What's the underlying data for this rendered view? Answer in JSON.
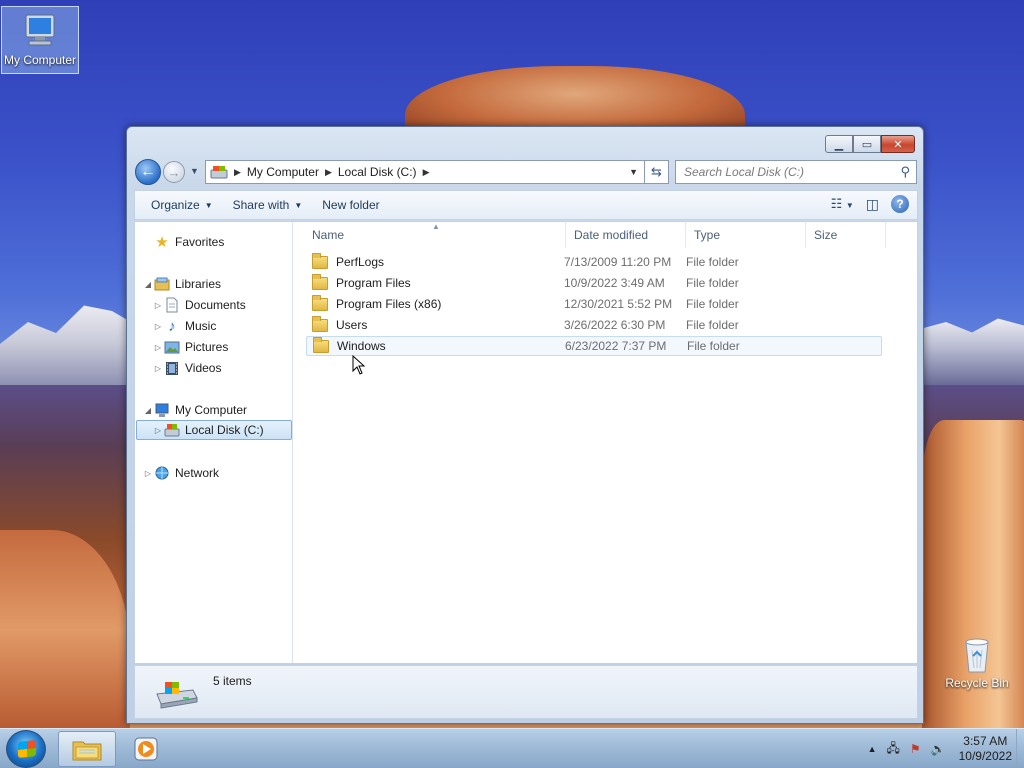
{
  "desktop": {
    "icons": [
      {
        "label": "My Computer",
        "icon": "computer-icon"
      },
      {
        "label": "Recycle Bin",
        "icon": "recycle-bin-icon"
      }
    ]
  },
  "window": {
    "controls": {
      "minimize": "minimize",
      "maximize": "maximize",
      "close": "close"
    },
    "address": {
      "crumbs": [
        "My Computer",
        "Local Disk (C:)"
      ]
    },
    "search": {
      "placeholder": "Search Local Disk (C:)"
    },
    "toolbar": {
      "organize": "Organize",
      "share_with": "Share with",
      "new_folder": "New folder"
    },
    "nav": {
      "favorites": "Favorites",
      "libraries": "Libraries",
      "documents": "Documents",
      "music": "Music",
      "pictures": "Pictures",
      "videos": "Videos",
      "my_computer": "My Computer",
      "local_disk": "Local Disk (C:)",
      "network": "Network"
    },
    "columns": {
      "name": "Name",
      "date": "Date modified",
      "type": "Type",
      "size": "Size"
    },
    "files": [
      {
        "name": "PerfLogs",
        "date": "7/13/2009 11:20 PM",
        "type": "File folder"
      },
      {
        "name": "Program Files",
        "date": "10/9/2022 3:49 AM",
        "type": "File folder"
      },
      {
        "name": "Program Files (x86)",
        "date": "12/30/2021 5:52 PM",
        "type": "File folder"
      },
      {
        "name": "Users",
        "date": "3/26/2022 6:30 PM",
        "type": "File folder"
      },
      {
        "name": "Windows",
        "date": "6/23/2022 7:37 PM",
        "type": "File folder"
      }
    ],
    "status": {
      "item_count": "5 items"
    }
  },
  "taskbar": {
    "clock_time": "3:57 AM",
    "clock_date": "10/9/2022"
  },
  "colors": {
    "accent": "#2b6ec8",
    "selection": "#cbe3f7"
  }
}
